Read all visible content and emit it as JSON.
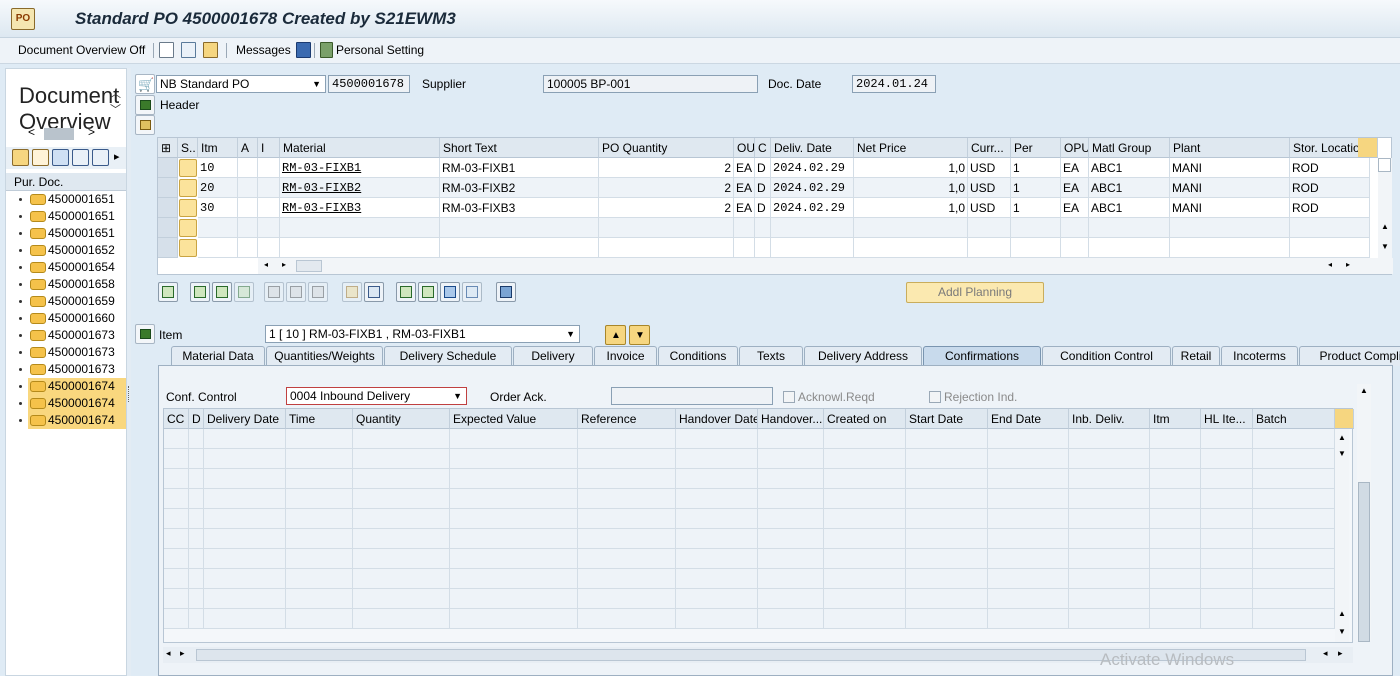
{
  "window": {
    "title": "Standard PO 4500001678 Created by S21EWM3"
  },
  "toolbar": {
    "doc_overview_label": "Document Overview Off",
    "messages_label": "Messages",
    "personal_setting_label": "Personal Setting"
  },
  "left_panel": {
    "title": "Document Overview",
    "column_header": "Pur. Doc.",
    "items": [
      {
        "number": "4500001651",
        "selected": false
      },
      {
        "number": "4500001651",
        "selected": false
      },
      {
        "number": "4500001651",
        "selected": false
      },
      {
        "number": "4500001652",
        "selected": false
      },
      {
        "number": "4500001654",
        "selected": false
      },
      {
        "number": "4500001658",
        "selected": false
      },
      {
        "number": "4500001659",
        "selected": false
      },
      {
        "number": "4500001660",
        "selected": false
      },
      {
        "number": "4500001673",
        "selected": false
      },
      {
        "number": "4500001673",
        "selected": false
      },
      {
        "number": "4500001673",
        "selected": false
      },
      {
        "number": "4500001674",
        "selected": true
      },
      {
        "number": "4500001674",
        "selected": true
      },
      {
        "number": "4500001674",
        "selected": true
      }
    ]
  },
  "header": {
    "po_type": "NB Standard PO",
    "po_number": "4500001678",
    "supplier_label": "Supplier",
    "supplier_value": "100005 BP-001",
    "doc_date_label": "Doc. Date",
    "doc_date_value": "2024.01.24",
    "header_label": "Header"
  },
  "items_table": {
    "columns": [
      "S..",
      "Itm",
      "A",
      "I",
      "Material",
      "Short Text",
      "PO Quantity",
      "OUn",
      "C",
      "Deliv. Date",
      "Net Price",
      "Curr...",
      "Per",
      "OPU",
      "Matl Group",
      "Plant",
      "Stor. Location"
    ],
    "rows": [
      {
        "itm": "10",
        "material": "RM-03-FIXB1",
        "short_text": "RM-03-FIXB1",
        "qty": "2",
        "oun": "EA",
        "c": "D",
        "deliv": "2024.02.29",
        "price": "1,0",
        "curr": "USD",
        "per": "1",
        "opu": "EA",
        "matl_group": "ABC1",
        "plant": "MANI",
        "sloc": "ROD"
      },
      {
        "itm": "20",
        "material": "RM-03-FIXB2",
        "short_text": "RM-03-FIXB2",
        "qty": "2",
        "oun": "EA",
        "c": "D",
        "deliv": "2024.02.29",
        "price": "1,0",
        "curr": "USD",
        "per": "1",
        "opu": "EA",
        "matl_group": "ABC1",
        "plant": "MANI",
        "sloc": "ROD"
      },
      {
        "itm": "30",
        "material": "RM-03-FIXB3",
        "short_text": "RM-03-FIXB3",
        "qty": "2",
        "oun": "EA",
        "c": "D",
        "deliv": "2024.02.29",
        "price": "1,0",
        "curr": "USD",
        "per": "1",
        "opu": "EA",
        "matl_group": "ABC1",
        "plant": "MANI",
        "sloc": "ROD"
      }
    ]
  },
  "addl_planning_label": "Addl Planning",
  "item_section": {
    "label": "Item",
    "selected_item": "1 [ 10 ] RM-03-FIXB1 , RM-03-FIXB1"
  },
  "tabs": [
    "Material Data",
    "Quantities/Weights",
    "Delivery Schedule",
    "Delivery",
    "Invoice",
    "Conditions",
    "Texts",
    "Delivery Address",
    "Confirmations",
    "Condition Control",
    "Retail",
    "Incoterms",
    "Product Compliance"
  ],
  "active_tab": "Confirmations",
  "confirmations": {
    "conf_control_label": "Conf. Control",
    "conf_control_value": "0004 Inbound Delivery",
    "order_ack_label": "Order Ack.",
    "order_ack_value": "",
    "acknowl_reqd_label": "Acknowl.Reqd",
    "rejection_ind_label": "Rejection Ind.",
    "columns": [
      "CC",
      "D",
      "Delivery Date",
      "Time",
      "Quantity",
      "Expected Value",
      "Reference",
      "Handover Date",
      "Handover...",
      "Created on",
      "Start Date",
      "End Date",
      "Inb. Deliv.",
      "Itm",
      "HL Ite...",
      "Batch"
    ]
  },
  "watermark": "Activate Windows"
}
